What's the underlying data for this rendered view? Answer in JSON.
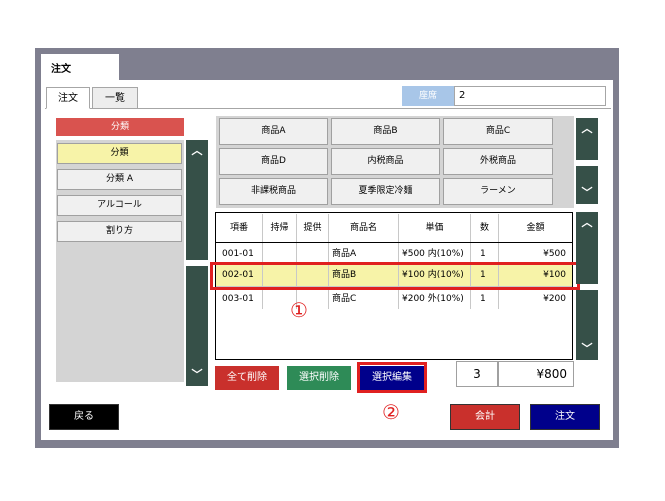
{
  "window": {
    "tab_title": "注文"
  },
  "tabs": [
    {
      "label": "注文"
    },
    {
      "label": "一覧"
    }
  ],
  "seat": {
    "label": "座席",
    "value": "2"
  },
  "categories": {
    "header": "分類",
    "items": [
      {
        "label": "分類"
      },
      {
        "label": "分類 A"
      },
      {
        "label": "アルコール"
      },
      {
        "label": "割り方"
      }
    ]
  },
  "products": [
    {
      "label": "商品A"
    },
    {
      "label": "商品B"
    },
    {
      "label": "商品C"
    },
    {
      "label": "商品D"
    },
    {
      "label": "内税商品"
    },
    {
      "label": "外税商品"
    },
    {
      "label": "非課税商品"
    },
    {
      "label": "夏季限定冷麺"
    },
    {
      "label": "ラーメン"
    }
  ],
  "order_table": {
    "headers": [
      "項番",
      "持帰",
      "提供",
      "商品名",
      "単価",
      "数",
      "金額"
    ],
    "rows": [
      {
        "no": "001-01",
        "takeout": "",
        "served": "",
        "name": "商品A",
        "price": "¥500 内(10%)",
        "qty": "1",
        "amount": "¥500"
      },
      {
        "no": "002-01",
        "takeout": "",
        "served": "",
        "name": "商品B",
        "price": "¥100 内(10%)",
        "qty": "1",
        "amount": "¥100"
      },
      {
        "no": "003-01",
        "takeout": "",
        "served": "",
        "name": "商品C",
        "price": "¥200 外(10%)",
        "qty": "1",
        "amount": "¥200"
      }
    ]
  },
  "actions": {
    "delete_all": "全て削除",
    "delete_selected": "選択削除",
    "edit_selected": "選択編集"
  },
  "totals": {
    "count": "3",
    "amount": "¥800"
  },
  "annotations": {
    "one": "①",
    "two": "②"
  },
  "bottom": {
    "back": "戻る",
    "checkout": "会計",
    "order": "注文"
  },
  "colors": {
    "red": "#d9534f",
    "green": "#2e8b57",
    "navy": "#00008b",
    "highlight": "#e02020",
    "scroll": "#365048"
  }
}
